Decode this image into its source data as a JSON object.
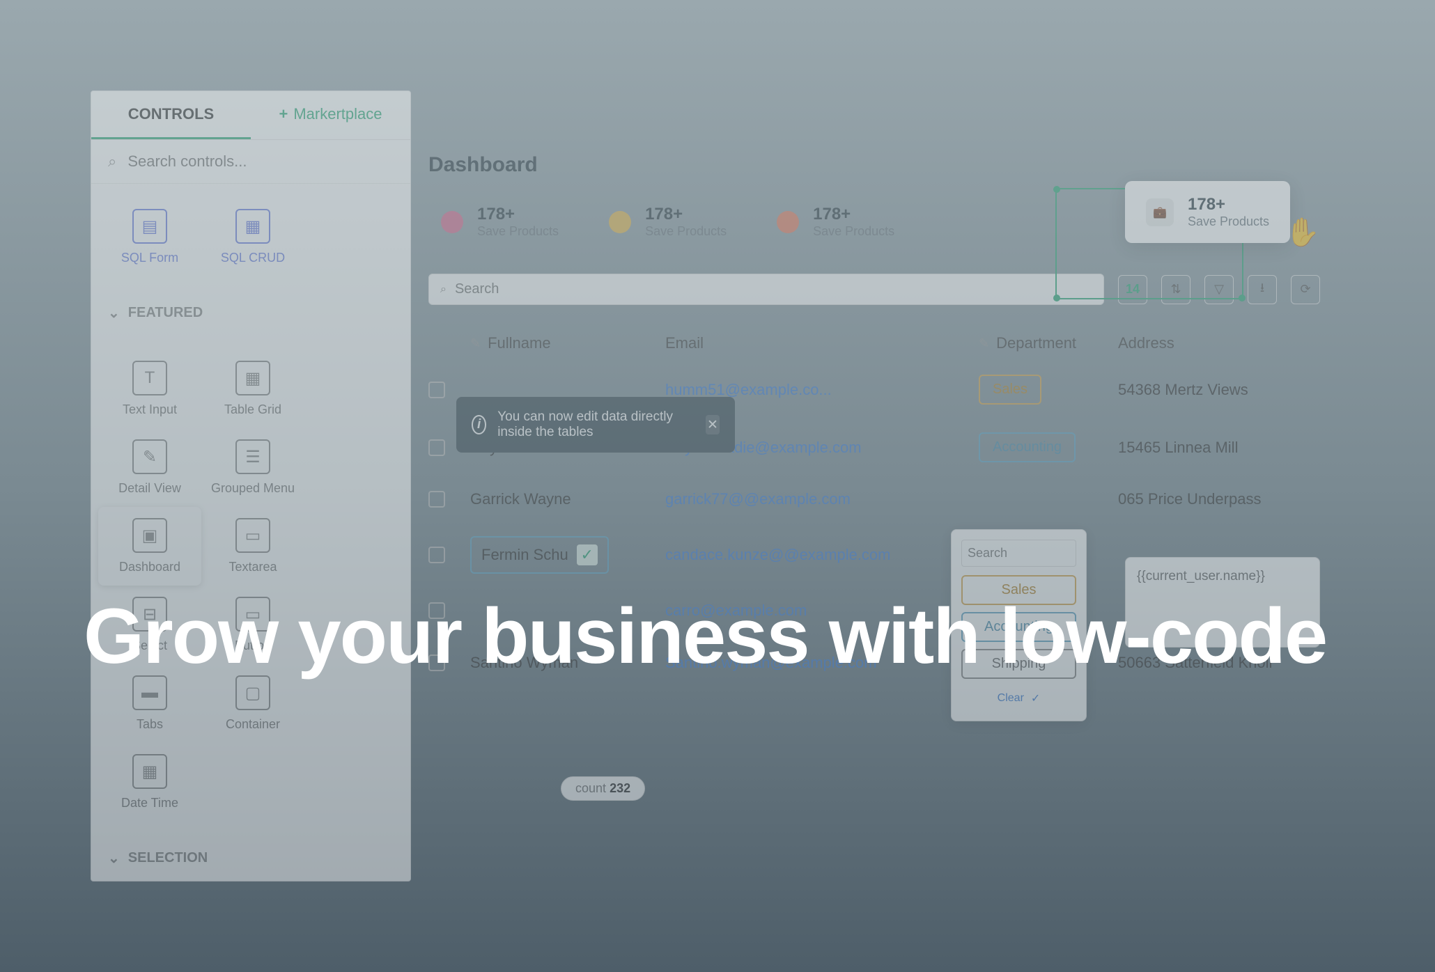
{
  "headline": "Grow your business with low-code",
  "sidebar": {
    "tabs": {
      "controls": "CONTROLS",
      "marketplace": "Markertplace"
    },
    "search_placeholder": "Search controls...",
    "top_controls": [
      {
        "label": "SQL Form"
      },
      {
        "label": "SQL CRUD"
      }
    ],
    "featured_header": "FEATURED",
    "featured": [
      {
        "label": "Text Input"
      },
      {
        "label": "Table Grid"
      },
      {
        "label": "Detail View"
      },
      {
        "label": "Grouped Menu"
      },
      {
        "label": "Dashboard"
      },
      {
        "label": "Textarea"
      },
      {
        "label": "Select"
      },
      {
        "label": "Button"
      },
      {
        "label": "Tabs"
      },
      {
        "label": "Container"
      },
      {
        "label": "Date Time"
      }
    ],
    "selection_header": "SELECTION"
  },
  "main": {
    "title": "Dashboard",
    "metrics": [
      {
        "value": "178+",
        "label": "Save Products",
        "color": "#d66a8f"
      },
      {
        "value": "178+",
        "label": "Save Products",
        "color": "#e2b54d"
      },
      {
        "value": "178+",
        "label": "Save Products",
        "color": "#e27a5e"
      }
    ],
    "floating": {
      "value": "178+",
      "label": "Save Products"
    },
    "search_placeholder": "Search",
    "toolbar_count": "14",
    "table": {
      "columns": {
        "fullname": "Fullname",
        "email": "Email",
        "department": "Department",
        "address": "Address"
      },
      "rows": [
        {
          "name": "",
          "email": "humm51@example.co...",
          "dept": "Sales",
          "addr": "54368 Mertz Views"
        },
        {
          "name": "Jalyn Labadie",
          "email": "Jalyn.labadie@example.com",
          "dept": "Accounting",
          "addr": "15465 Linnea Mill"
        },
        {
          "name": "Garrick Wayne",
          "email": "garrick77@@example.com",
          "dept": "",
          "addr": "065 Price Underpass"
        },
        {
          "name": "Fermin Schu",
          "email": "candace.kunze@@example.com",
          "dept": "",
          "addr": ""
        },
        {
          "name": "",
          "email": "carro@example.com",
          "dept": "",
          "addr": ""
        },
        {
          "name": "Santino Wyman",
          "email": "Santino.wyman@example.com",
          "dept": "Shipping",
          "addr": "50663 Satterfield Knoll"
        }
      ],
      "editing_name": "Fermin Schu",
      "count_label": "count",
      "count_value": "232"
    },
    "tooltip": "You can now edit data directly inside the tables",
    "dept_dropdown": {
      "search": "Search",
      "options": [
        "Sales",
        "Accounting",
        "Shipping"
      ],
      "clear": "Clear"
    },
    "expression": "{{current_user.name}}"
  }
}
